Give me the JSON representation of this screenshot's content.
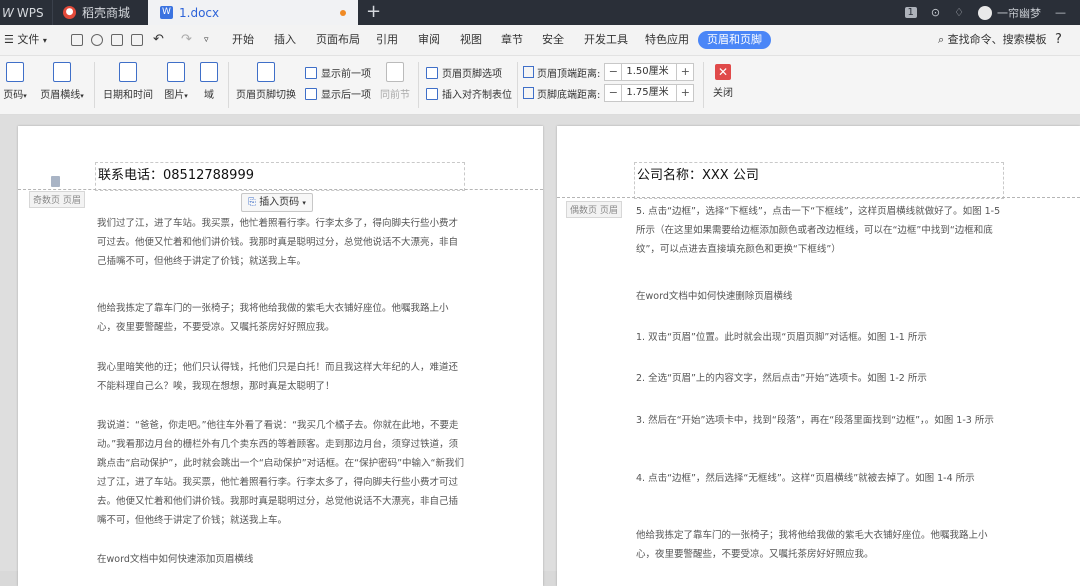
{
  "tabs": {
    "app": "WPS",
    "store": "稻壳商城",
    "doc": "1.docx",
    "new_tab": "+",
    "badge": "1",
    "user": "一帘幽梦",
    "minimize": "—"
  },
  "menu": {
    "file": "文件",
    "items": [
      "开始",
      "插入",
      "页面布局",
      "引用",
      "审阅",
      "视图",
      "章节",
      "安全",
      "开发工具",
      "特色应用"
    ],
    "active": "页眉和页脚",
    "search": "查找命令、搜索模板",
    "help": "?"
  },
  "ribbon": {
    "page_num": "页码",
    "header_line": "页眉横线",
    "date_time": "日期和时间",
    "picture": "图片",
    "field": "域",
    "switch": "页眉页脚切换",
    "show_prev": "显示前一项",
    "show_next": "显示后一项",
    "same_as_prev": "同前节",
    "hf_options": "页眉页脚选项",
    "insert_tab": "插入对齐制表位",
    "top_dist_label": "页眉顶端距离:",
    "top_dist_value": "1.50厘米",
    "bottom_dist_label": "页脚底端距离:",
    "bottom_dist_value": "1.75厘米",
    "close": "关闭",
    "minus": "−",
    "plus": "+"
  },
  "left_page": {
    "header_text": "联系电话：08512788999",
    "header_label": "奇数页 页眉",
    "insert_page_num": "插入页码",
    "paragraphs": [
      "我们过了江，进了车站。我买票，他忙着照看行李。行李太多了，得向脚夫行些小费才可过去。他便又忙着和他们讲价钱。我那时真是聪明过分，总觉他说话不大漂亮，非自己插嘴不可，但他终于讲定了价钱；就送我上车。",
      "他给我拣定了靠车门的一张椅子；我将他给我做的紫毛大衣铺好座位。他嘱我路上小心，夜里要警醒些，不要受凉。又嘱托茶房好好照应我。",
      "我心里暗笑他的迂；他们只认得钱，托他们只是白托！而且我这样大年纪的人，难道还不能料理自己么？唉，我现在想想，那时真是太聪明了！",
      "我说道：“爸爸，你走吧。”他往车外看了看说：“我买几个橘子去。你就在此地，不要走动。”我看那边月台的栅栏外有几个卖东西的等着顾客。走到那边月台，须穿过铁道，须跳点击“启动保护”，此时就会跳出一个“启动保护”对话框。在“保护密码”中输入“新我们过了江，进了车站。我买票，他忙着照看行李。行李太多了，得向脚夫行些小费才可过去。他便又忙着和他们讲价钱。我那时真是聪明过分，总觉他说话不大漂亮，非自己插嘴不可，但他终于讲定了价钱；就送我上车。",
      "在word文档中如何快速添加页眉横线"
    ]
  },
  "right_page": {
    "header_text": "公司名称：XXX 公司",
    "header_label": "偶数页 页眉",
    "paragraphs": [
      "5. 点击“边框”，选择“下框线”，点击一下“下框线”，这样页眉横线就做好了。如图 1-5 所示（在这里如果需要给边框添加颜色或者改边框线，可以在“边框”中找到“边框和底纹”，可以点进去直接填充颜色和更换“下框线”）",
      "在word文档中如何快速删除页眉横线",
      "1. 双击“页眉”位置。此时就会出现“页眉页脚”对话框。如图 1-1 所示",
      "2. 全选“页眉”上的内容文字，然后点击”开始”选项卡。如图 1-2 所示",
      "3. 然后在“开始”选项卡中，找到“段落”，再在“段落里面找到“边框”，。如图 1-3 所示",
      "4. 点击“边框”，然后选择“无框线”。这样“页眉横线”就被去掉了。如图 1-4 所示",
      "他给我拣定了靠车门的一张椅子；我将他给我做的紫毛大衣铺好座位。他嘱我路上小心，夜里要警醒些，不要受凉。又嘱托茶房好好照应我。"
    ]
  }
}
